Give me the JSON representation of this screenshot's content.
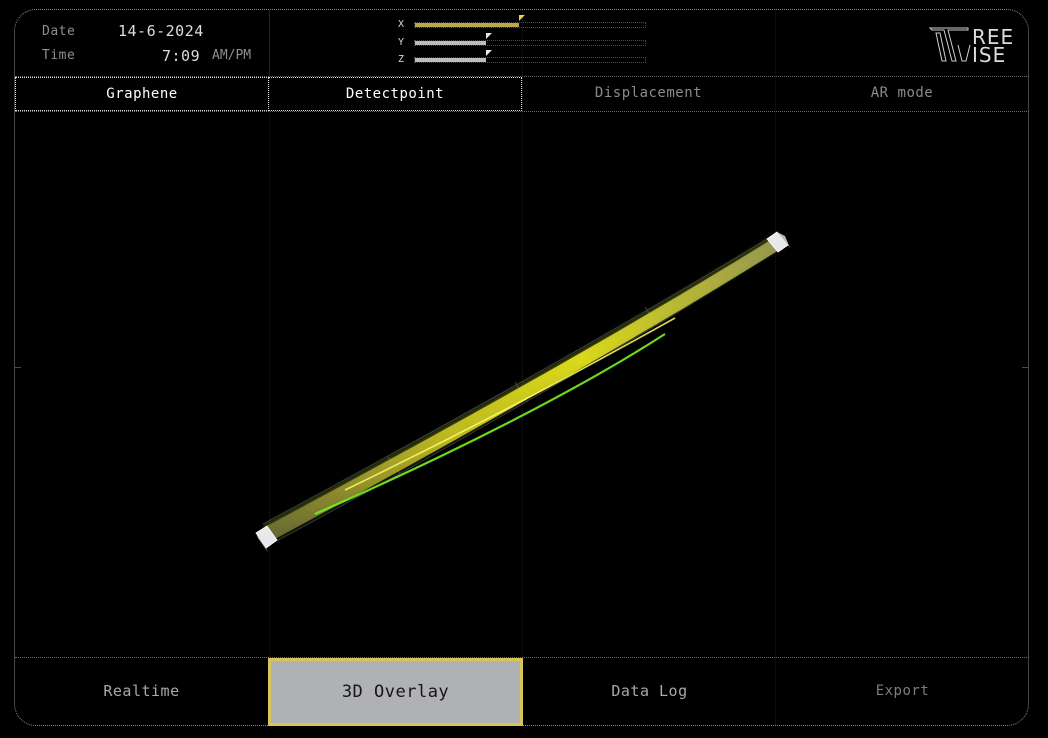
{
  "header": {
    "date_label": "Date",
    "date_value": "14-6-2024",
    "time_label": "Time",
    "time_value": "7:09",
    "time_suffix": "AM/PM"
  },
  "axes": [
    {
      "label": "X",
      "value": 0.45,
      "color": "#b8a84a"
    },
    {
      "label": "Y",
      "value": 0.31,
      "color": "#bdbdbd"
    },
    {
      "label": "Z",
      "value": 0.31,
      "color": "#bdbdbd"
    }
  ],
  "logo": {
    "line1": "REE",
    "line2": "ISE",
    "icon": "treewise-logo-mark"
  },
  "tabs": [
    {
      "label": "Graphene",
      "active": true
    },
    {
      "label": "Detectpoint",
      "active": true
    },
    {
      "label": "Displacement",
      "active": false
    },
    {
      "label": "AR mode",
      "active": false
    }
  ],
  "bottom_buttons": [
    {
      "label": "Realtime",
      "active": false
    },
    {
      "label": "3D Overlay",
      "active": true
    },
    {
      "label": "Data Log",
      "active": false
    },
    {
      "label": "Export",
      "active": false
    }
  ],
  "colors": {
    "accent_yellow": "#d8c55a",
    "beam_yellow": "#e6e21a",
    "beam_green": "#7cf01e",
    "active_button_bg": "#b0b1b5"
  }
}
